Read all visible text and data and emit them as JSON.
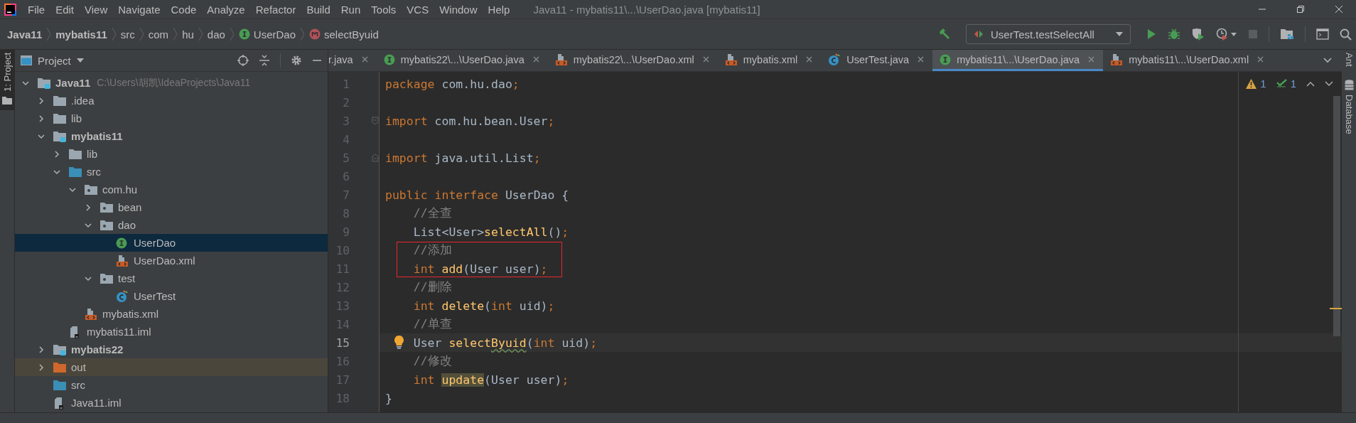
{
  "window": {
    "title": "Java11 - mybatis11\\...\\UserDao.java [mybatis11]"
  },
  "menu": [
    "File",
    "Edit",
    "View",
    "Navigate",
    "Code",
    "Analyze",
    "Refactor",
    "Build",
    "Run",
    "Tools",
    "VCS",
    "Window",
    "Help"
  ],
  "breadcrumbs": [
    {
      "label": "Java11",
      "kind": "module"
    },
    {
      "label": "mybatis11",
      "kind": "module"
    },
    {
      "label": "src",
      "kind": "folder"
    },
    {
      "label": "com",
      "kind": "folder"
    },
    {
      "label": "hu",
      "kind": "folder"
    },
    {
      "label": "dao",
      "kind": "folder"
    },
    {
      "label": "UserDao",
      "kind": "interface"
    },
    {
      "label": "selectByuid",
      "kind": "method"
    }
  ],
  "run_config": {
    "label": "UserTest.testSelectAll"
  },
  "toolbar": [
    {
      "kind": "run",
      "disabled": false
    },
    {
      "kind": "debug",
      "disabled": false
    },
    {
      "kind": "coverage",
      "disabled": false
    },
    {
      "kind": "profile",
      "disabled": false
    },
    {
      "kind": "stop",
      "disabled": true
    }
  ],
  "left_strip": {
    "label": "1: Project"
  },
  "right_strip": [
    {
      "label": "Ant",
      "kind": "plain"
    },
    {
      "label": "Database",
      "kind": "database"
    }
  ],
  "project_panel": {
    "title": "Project",
    "tree": [
      {
        "label": "Java11",
        "kind": "module",
        "detail": "C:\\Users\\胡凯\\IdeaProjects\\Java11",
        "expanded": true,
        "selected": false,
        "children": [
          {
            "label": ".idea",
            "kind": "folder",
            "expanded": false,
            "selected": false
          },
          {
            "label": "lib",
            "kind": "folder",
            "expanded": false,
            "selected": false
          },
          {
            "label": "mybatis11",
            "kind": "module",
            "expanded": true,
            "selected": false,
            "children": [
              {
                "label": "lib",
                "kind": "folder",
                "expanded": false,
                "selected": false
              },
              {
                "label": "src",
                "kind": "source",
                "expanded": true,
                "selected": false,
                "children": [
                  {
                    "label": "com.hu",
                    "kind": "package",
                    "expanded": true,
                    "selected": false,
                    "children": [
                      {
                        "label": "bean",
                        "kind": "package",
                        "expanded": false,
                        "selected": false
                      },
                      {
                        "label": "dao",
                        "kind": "package",
                        "expanded": true,
                        "selected": false,
                        "children": [
                          {
                            "label": "UserDao",
                            "kind": "interface",
                            "selected": true
                          },
                          {
                            "label": "UserDao.xml",
                            "kind": "xml",
                            "selected": false
                          }
                        ]
                      },
                      {
                        "label": "test",
                        "kind": "package",
                        "expanded": true,
                        "selected": false,
                        "children": [
                          {
                            "label": "UserTest",
                            "kind": "testclass",
                            "selected": false
                          }
                        ]
                      }
                    ]
                  },
                  {
                    "label": "mybatis.xml",
                    "kind": "xml",
                    "selected": false
                  }
                ]
              },
              {
                "label": "mybatis11.iml",
                "kind": "iml",
                "selected": false
              }
            ]
          },
          {
            "label": "mybatis22",
            "kind": "module",
            "expanded": false,
            "selected": false
          },
          {
            "label": "out",
            "kind": "excluded",
            "expanded": false,
            "selected": false
          },
          {
            "label": "src",
            "kind": "source",
            "selected": false
          },
          {
            "label": "Java11.iml",
            "kind": "iml",
            "selected": false
          }
        ]
      }
    ]
  },
  "tabs": [
    {
      "label": "r.java",
      "kind": "plain",
      "selected": false
    },
    {
      "label": "mybatis22\\...\\UserDao.java",
      "kind": "interface",
      "selected": false
    },
    {
      "label": "mybatis22\\...\\UserDao.xml",
      "kind": "xml",
      "selected": false
    },
    {
      "label": "mybatis.xml",
      "kind": "xml",
      "selected": false
    },
    {
      "label": "UserTest.java",
      "kind": "testclass",
      "selected": false
    },
    {
      "label": "mybatis11\\...\\UserDao.java",
      "kind": "interface",
      "selected": true
    },
    {
      "label": "mybatis11\\...\\UserDao.xml",
      "kind": "xml",
      "selected": false
    }
  ],
  "inspections": {
    "warnings": "1",
    "weak_warnings": "1"
  },
  "lines": [
    {
      "number": "1",
      "tokens": [
        {
          "kind": "keyword",
          "text": "package "
        },
        {
          "kind": "plain",
          "text": "com.hu.dao"
        },
        {
          "kind": "keyword",
          "text": ";"
        }
      ]
    },
    {
      "number": "2"
    },
    {
      "number": "3",
      "fold_start": true,
      "tokens": [
        {
          "kind": "keyword",
          "text": "import "
        },
        {
          "kind": "plain",
          "text": "com.hu.bean.User"
        },
        {
          "kind": "keyword",
          "text": ";"
        }
      ]
    },
    {
      "number": "4"
    },
    {
      "number": "5",
      "fold_end": true,
      "tokens": [
        {
          "kind": "keyword",
          "text": "import "
        },
        {
          "kind": "plain",
          "text": "java.util.List"
        },
        {
          "kind": "keyword",
          "text": ";"
        }
      ]
    },
    {
      "number": "6"
    },
    {
      "number": "7",
      "tokens": [
        {
          "kind": "keyword",
          "text": "public interface "
        },
        {
          "kind": "plain",
          "text": "UserDao {"
        }
      ]
    },
    {
      "number": "8",
      "indented": true,
      "tokens": [
        {
          "kind": "comment",
          "text": "//全查"
        }
      ]
    },
    {
      "number": "9",
      "indented": true,
      "tokens": [
        {
          "kind": "plain",
          "text": "List<User>"
        },
        {
          "kind": "method",
          "text": "selectAll"
        },
        {
          "kind": "plain",
          "text": "()"
        },
        {
          "kind": "keyword",
          "text": ";"
        }
      ]
    },
    {
      "number": "10",
      "indented": true,
      "boxed": true,
      "tokens": [
        {
          "kind": "comment",
          "text": "//添加"
        }
      ]
    },
    {
      "number": "11",
      "indented": true,
      "boxed": true,
      "tokens": [
        {
          "kind": "keyword",
          "text": "int "
        },
        {
          "kind": "method",
          "text": "add"
        },
        {
          "kind": "plain",
          "text": "(User user)"
        },
        {
          "kind": "keyword",
          "text": ";"
        }
      ]
    },
    {
      "number": "12",
      "indented": true,
      "tokens": [
        {
          "kind": "comment",
          "text": "//删除"
        }
      ]
    },
    {
      "number": "13",
      "indented": true,
      "tokens": [
        {
          "kind": "keyword",
          "text": "int "
        },
        {
          "kind": "method",
          "text": "delete"
        },
        {
          "kind": "plain",
          "text": "("
        },
        {
          "kind": "keyword",
          "text": "int "
        },
        {
          "kind": "plain",
          "text": "uid)"
        },
        {
          "kind": "keyword",
          "text": ";"
        }
      ]
    },
    {
      "number": "14",
      "indented": true,
      "tokens": [
        {
          "kind": "comment",
          "text": "//单查"
        }
      ]
    },
    {
      "number": "15",
      "indented": true,
      "current": true,
      "bulb": true,
      "tokens": [
        {
          "kind": "plain",
          "text": "User "
        },
        {
          "kind": "method",
          "text": "select"
        },
        {
          "kind": "typo",
          "text": "Byuid"
        },
        {
          "kind": "plain",
          "text": "("
        },
        {
          "kind": "keyword",
          "text": "int "
        },
        {
          "kind": "plain",
          "text": "uid)"
        },
        {
          "kind": "keyword",
          "text": ";"
        }
      ]
    },
    {
      "number": "16",
      "indented": true,
      "tokens": [
        {
          "kind": "comment",
          "text": "//修改"
        }
      ]
    },
    {
      "number": "17",
      "indented": true,
      "tokens": [
        {
          "kind": "keyword",
          "text": "int "
        },
        {
          "kind": "usage",
          "text": "update"
        },
        {
          "kind": "plain",
          "text": "(User user)"
        },
        {
          "kind": "keyword",
          "text": ";"
        }
      ]
    },
    {
      "number": "18",
      "tokens": [
        {
          "kind": "plain",
          "text": "}"
        }
      ]
    }
  ]
}
